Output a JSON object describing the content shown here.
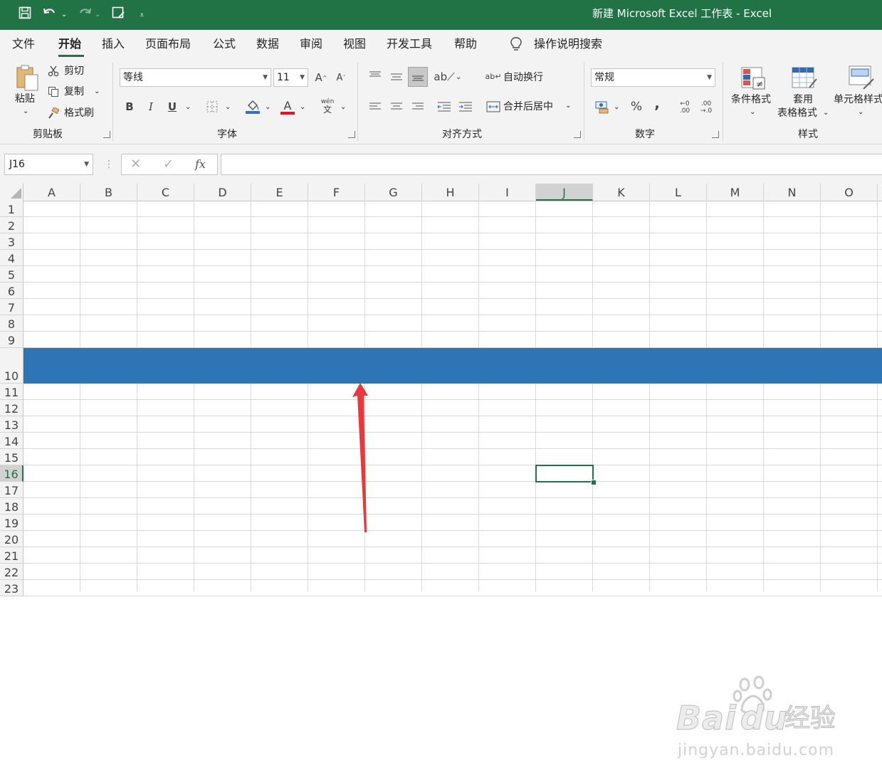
{
  "title_bar": {
    "title": "新建 Microsoft Excel 工作表  -  Excel",
    "quick_access": [
      "save-icon",
      "undo-icon",
      "redo-icon",
      "save-as-icon",
      "customize-icon"
    ]
  },
  "menu": {
    "tabs": [
      "文件",
      "开始",
      "插入",
      "页面布局",
      "公式",
      "数据",
      "审阅",
      "视图",
      "开发工具",
      "帮助"
    ],
    "active_tab": "开始",
    "search_label": "操作说明搜索"
  },
  "ribbon": {
    "clipboard": {
      "paste": "粘贴",
      "cut": "剪切",
      "copy": "复制",
      "format_painter": "格式刷",
      "group": "剪贴板"
    },
    "font": {
      "font_name": "等线",
      "font_size": "11",
      "bold": "B",
      "italic": "I",
      "underline": "U",
      "font_color_letter": "A",
      "phonetic_top": "wén",
      "phonetic_bottom": "文",
      "group": "字体",
      "fill_color": "#3470c4",
      "font_color": "#e81123"
    },
    "alignment": {
      "wrap_text": "自动换行",
      "merge_center": "合并后居中",
      "group": "对齐方式"
    },
    "number": {
      "format": "常规",
      "percent": "%",
      "comma": ",",
      "dec_inc_top": "←0",
      "dec_inc_bottom": ".00",
      "dec_dec_top": ".00",
      "dec_dec_bottom": "→.0",
      "group": "数字"
    },
    "styles": {
      "conditional": "条件格式",
      "table_fmt_1": "套用",
      "table_fmt_2": "表格格式",
      "cell_styles": "单元格样式",
      "group": "样式"
    }
  },
  "formula_bar": {
    "name_box": "J16",
    "cancel": "✕",
    "enter": "✓",
    "fx": "fx",
    "formula": ""
  },
  "sheet": {
    "columns": [
      "A",
      "B",
      "C",
      "D",
      "E",
      "F",
      "G",
      "H",
      "I",
      "J",
      "K",
      "L",
      "M",
      "N",
      "O"
    ],
    "rows": [
      "1",
      "2",
      "3",
      "4",
      "5",
      "6",
      "7",
      "8",
      "9",
      "10",
      "11",
      "12",
      "13",
      "14",
      "15",
      "16",
      "17",
      "18",
      "19",
      "20",
      "21",
      "22",
      "23"
    ],
    "selected_column": "J",
    "selected_row": "16",
    "highlighted_row": "10",
    "highlight_color": "#2e75b6",
    "accent_color": "#217346",
    "annotation_color": "#e8383d"
  },
  "watermark": {
    "brand": "Bai",
    "brand_2": "du",
    "brand_cn": "经验",
    "url": "jingyan.baidu.com"
  }
}
